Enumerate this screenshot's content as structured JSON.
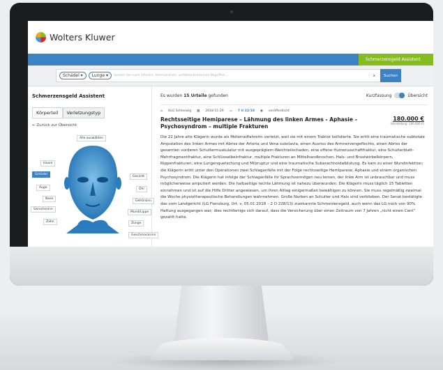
{
  "brand": {
    "name": "Wolters Kluwer",
    "green_tab": "Schmerzensgeld Assistent",
    "colors": {
      "blue": "#3d82c4",
      "green": "#85bc20"
    }
  },
  "search": {
    "chips": [
      "Schädel",
      "Lunge"
    ],
    "placeholder": "Suchen Sie nach Urteilen, Aktenzeichen, unfallmedizinischen Begriffen...",
    "clear": "x",
    "button": "Suchen"
  },
  "left": {
    "title": "Schmerzensgeld Assistent",
    "tabs": [
      "Körperteil",
      "Verletzungstyp"
    ],
    "back": "← Zurück zur Übersicht",
    "select_all": "Alle auswählen",
    "labels_left": [
      "Haare",
      "Schädel",
      "Auge",
      "Nase",
      "Gerochssinn",
      "Zahn"
    ],
    "labels_right": [
      "Gesicht",
      "Ohr",
      "Gehörsinn",
      "Mund/Lippe",
      "Zunge",
      "Geschmacksinn"
    ]
  },
  "results": {
    "prefix": "Es wurden",
    "count": "15 Urteile",
    "suffix": "gefunden",
    "toggle_left": "Kurzfassung",
    "toggle_right": "Übersicht"
  },
  "card": {
    "court": "OLG Schleswig",
    "date": "2018-11-29",
    "file": "7 U 22/18",
    "status": "veröffentlicht",
    "title": "Rechtsseitige Hemiparese – Lähmung des linken Armes - Aphasie – Psychosyndrom – multiple Frakturen",
    "amount": "180.000 €",
    "amount_sub": "(Vorstellung: 100.000 €)",
    "text": "Die 22 Jahre alte Klägerin wurde als Motorradfahrerin verletzt, weil sie mit einem Traktor kollidierte. Sie erlitt eine traumatische subtotale Amputation des linken Armes mit Abriss der Arteria und Vena subclavia, einen Ausriss des Armnervengeflechts, einen Abriss der gesamten vorderen Schultermuskulatur mit ausgeprägtem Weichteilschaden, eine offene Humerusschaftfraktur, eine Schulterblatt-Mehrfragmentfraktur, eine Schlüsselbeinfraktur, multiple Frakturen an Mittelhandknochen, Hals- und Brustwirbelkörpern, Rippenfrakturen, eine Lungenquetschung und Milzruptur und eine traumatische Subarachnoidalblutung. Es kam zu einer Wundinfektion; die Klägerin erlitt unter den Operationen zwei Schlaganfälle mit der Folge rechtsseitige Hemiparese, Aphasie und einem organischen Psychosyndrom. Die Klägerin hat infolge der Schlaganfälle ihr Sprachvermögen neu lernen, der linke Arm ist unbrauchbar und muss möglicherweise amputiert werden. Die halbseitige rechte Lähmung ist nahezu überwunden. Die Klägerin muss täglich 15 Tabletten einnehmen und ist auf die Hilfe Dritter angewiesen, um ihren Alltag einigermaßen bewältigen zu können. Sie muss regelmäßig zweimal die Woche physiotherapeutische Behandlungen wahrnehmen. Große Narben an Schulter und Hals sind verblieben. Der Senat bestätigte das vom Landgericht (LG Flensburg, Urt. v. 05.01.2018 – 2 O 228/13) zuerkannte Schmerzensgeld, auch wenn das LG noch von 90% Haftung ausgegangen war; dies rechtfertige sich darauf, dass die Versicherung über einen Zeitraum von 7 Jahren „nicht einen Cent“ gezahlt hatte."
  }
}
